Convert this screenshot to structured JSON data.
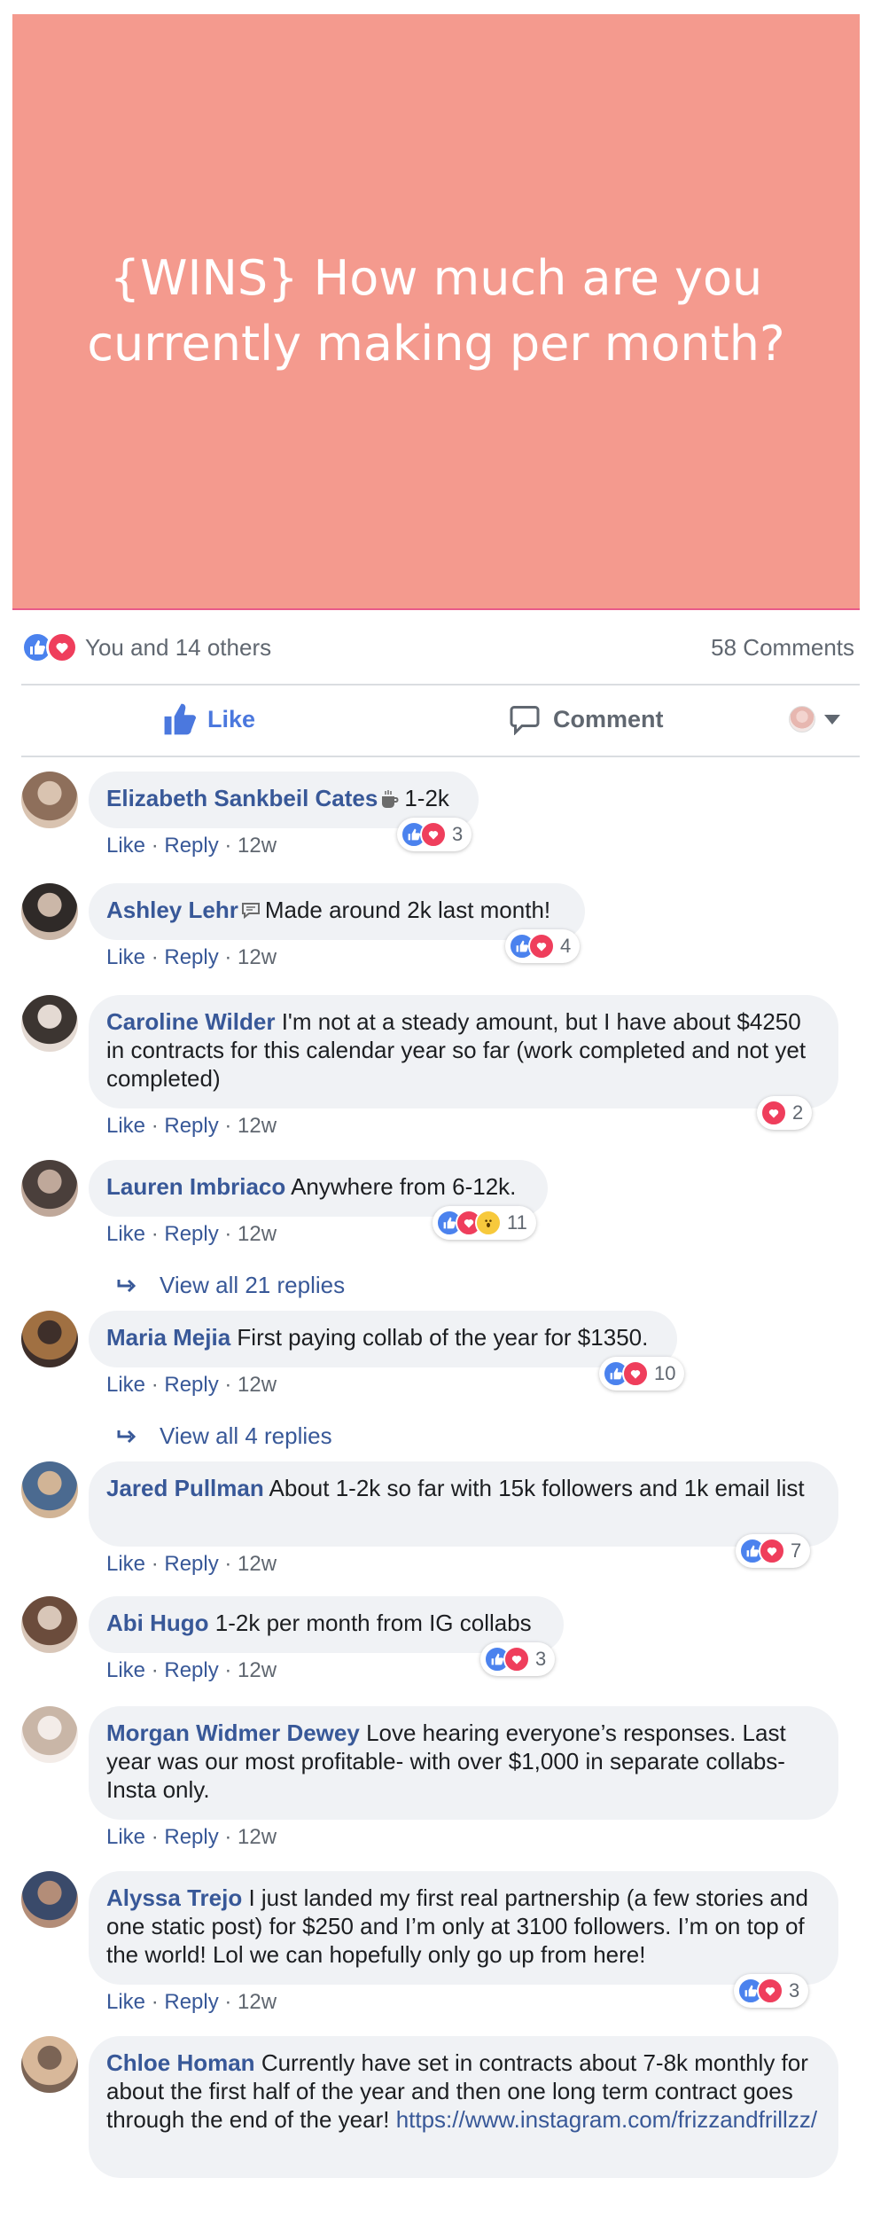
{
  "post": {
    "title": "{WINS} How much are you currently making per month?",
    "background_color": "#f49a8e",
    "reactions_text": "You and 14 others",
    "reactions": [
      "like",
      "love"
    ],
    "comments_count": "58 Comments"
  },
  "actions": {
    "like_label": "Like",
    "comment_label": "Comment"
  },
  "comment_meta": {
    "like": "Like",
    "sep": " · ",
    "reply": "Reply",
    "time": "12w"
  },
  "comments": [
    {
      "name": "Elizabeth Sankbeil Cates",
      "text": "1-2k",
      "icon": "coffee-cup-icon",
      "reactions": [
        "like",
        "love"
      ],
      "count": "3"
    },
    {
      "name": "Ashley Lehr",
      "text": "Made around 2k last month!",
      "icon": "speech-bubble-icon",
      "reactions": [
        "like",
        "love"
      ],
      "count": "4"
    },
    {
      "name": "Caroline Wilder",
      "text": "I'm not at a steady amount, but I have about $4250 in contracts for this calendar year so far (work completed and not yet completed)",
      "reactions": [
        "love"
      ],
      "count": "2"
    },
    {
      "name": "Lauren Imbriaco",
      "text": "Anywhere from 6-12k.",
      "reactions": [
        "like",
        "love",
        "wow"
      ],
      "count": "11",
      "replies": "View all 21 replies"
    },
    {
      "name": "Maria Mejia",
      "text": "First paying collab of the year for $1350.",
      "reactions": [
        "like",
        "love"
      ],
      "count": "10",
      "replies": "View all 4 replies"
    },
    {
      "name": "Jared Pullman",
      "text": "About 1-2k so far with 15k followers and 1k email list",
      "reactions": [
        "like",
        "love"
      ],
      "count": "7"
    },
    {
      "name": "Abi Hugo",
      "text": "1-2k per month from IG collabs",
      "reactions": [
        "like",
        "love"
      ],
      "count": "3"
    },
    {
      "name": "Morgan Widmer Dewey",
      "text": "Love hearing everyone’s responses. Last year was our most profitable- with over $1,000 in separate collabs- Insta only."
    },
    {
      "name": "Alyssa Trejo",
      "text": "I just landed my first real partnership (a few stories and one static post) for $250 and I’m only at 3100 followers. I’m on top of the world! Lol we can hopefully only go up from here!",
      "reactions": [
        "like",
        "love"
      ],
      "count": "3"
    },
    {
      "name": "Chloe Homan",
      "text": "Currently have set in contracts about 7-8k monthly for about the first half of the year and then one long term contract goes through the end of the year!",
      "link": "https://www.instagram.com/frizzandfrillzz/"
    }
  ]
}
